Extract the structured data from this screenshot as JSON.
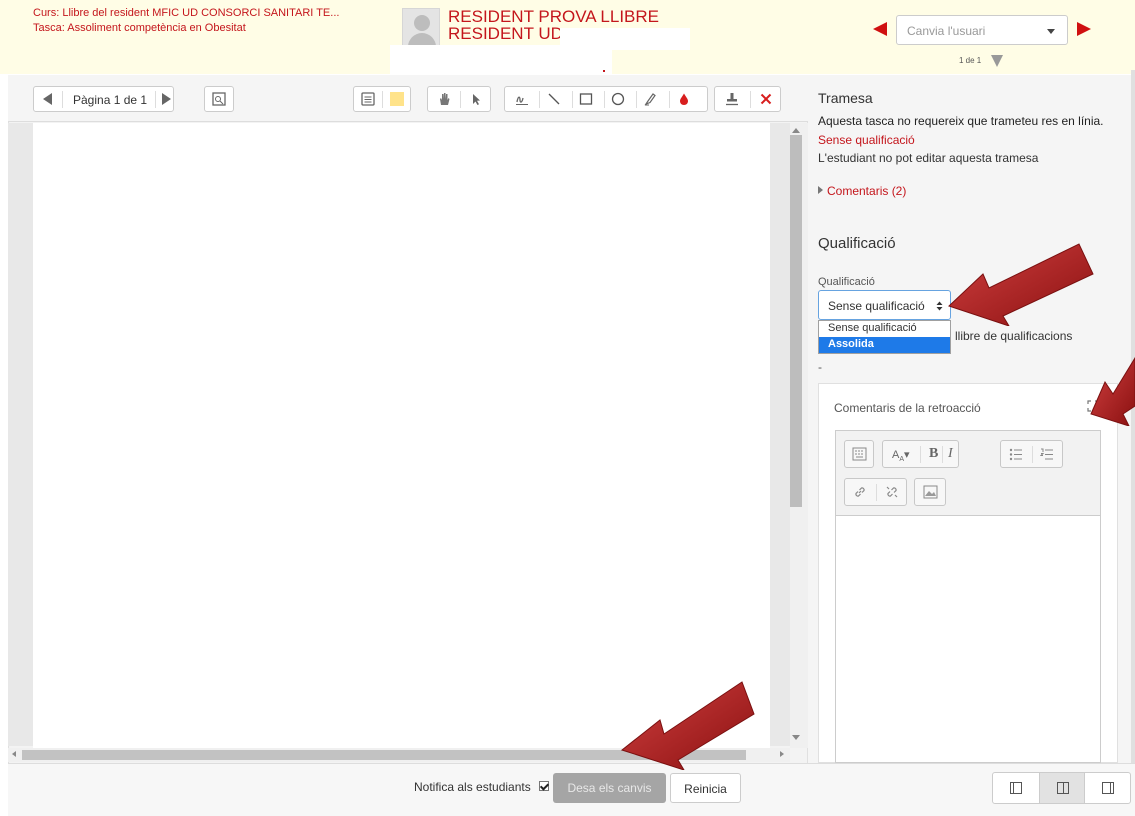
{
  "header": {
    "course": "Curs: Llibre del resident MFIC UD CONSORCI SANITARI TE...",
    "task": "Tasca: Assoliment competència en Obesitat",
    "student_line1": "RESIDENT PROVA LLIBRE",
    "student_line2": "RESIDENT UD",
    "user_select_placeholder": "Canvia l'usuari",
    "user_count": "1 de 1"
  },
  "toolbar": {
    "page_label": "Pàgina 1 de 1"
  },
  "submission": {
    "title": "Tramesa",
    "no_online": "Aquesta tasca no requereix que trameteu res en línia.",
    "status": "Sense qualificació",
    "cannot_edit": "L'estudiant no pot editar aquesta tramesa",
    "comments": "Comentaris (2)"
  },
  "grade": {
    "heading": "Qualificació",
    "label": "Qualificació",
    "selected": "Sense qualificació",
    "options": [
      "Sense qualificació",
      "Assolida"
    ],
    "gradebook": "llibre de qualificacions",
    "dash": "-"
  },
  "feedback": {
    "label": "Comentaris de la retroacció"
  },
  "footer": {
    "notify": "Notifica als estudiants",
    "save": "Desa els canvis",
    "reset": "Reinicia"
  },
  "colors": {
    "accent_red": "#c4161c",
    "selection_blue": "#1e7ae8",
    "header_bg": "#fffde6"
  }
}
